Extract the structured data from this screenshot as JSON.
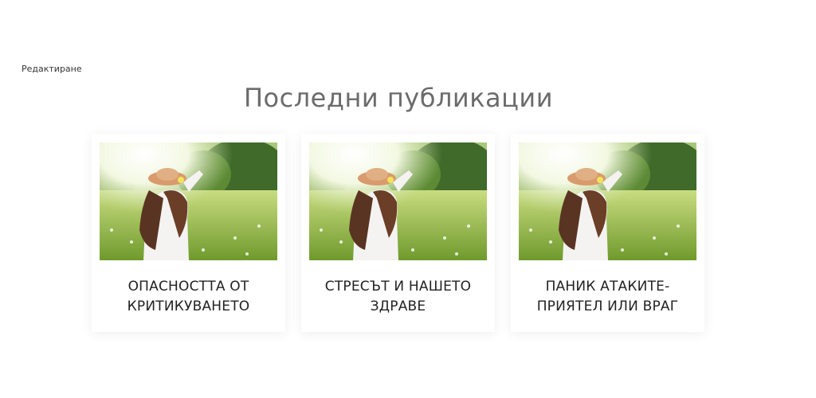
{
  "edit_link": "Редактиране",
  "section_title": "Последни публикации",
  "posts": [
    {
      "title_line1": "ОПАСНОСТТА ОТ",
      "title_line2": "КРИТИКУВАНЕТО"
    },
    {
      "title_line1": "СТРЕСЪТ И НАШЕТО",
      "title_line2": "ЗДРАВЕ"
    },
    {
      "title_line1": "ПАНИК АТАКИТЕ-",
      "title_line2": "ПРИЯТЕЛ ИЛИ ВРАГ"
    }
  ],
  "image_subject": "woman-in-meadow-photo"
}
